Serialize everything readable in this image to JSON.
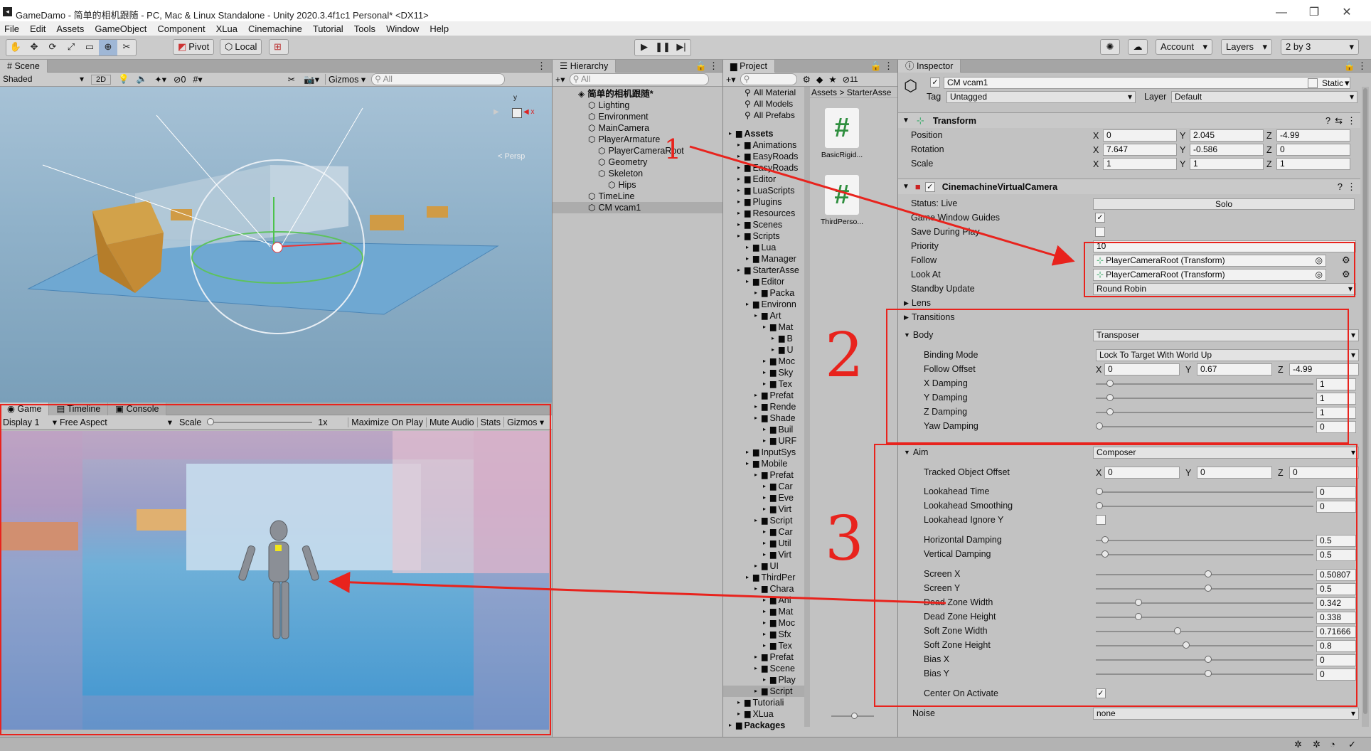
{
  "window": {
    "title": "GameDamo - 简单的相机跟随 - PC, Mac & Linux Standalone - Unity 2020.3.4f1c1 Personal* <DX11>"
  },
  "menu": [
    "File",
    "Edit",
    "Assets",
    "GameObject",
    "Component",
    "XLua",
    "Cinemachine",
    "Tutorial",
    "Tools",
    "Window",
    "Help"
  ],
  "toolbar": {
    "pivot": "Pivot",
    "local": "Local",
    "account": "Account",
    "layers": "Layers",
    "layout": "2 by 3"
  },
  "scene": {
    "tab": "Scene",
    "shading": "Shaded",
    "mode2d": "2D",
    "gizmos": "Gizmos",
    "search_placeholder": "All",
    "persp": "< Persp",
    "hidden_count": "0"
  },
  "game": {
    "tabs": [
      "Game",
      "Timeline",
      "Console"
    ],
    "display": "Display 1",
    "aspect": "Free Aspect",
    "scale_label": "Scale",
    "scale_value": "1x",
    "max_on_play": "Maximize On Play",
    "mute": "Mute Audio",
    "stats": "Stats",
    "gizmos": "Gizmos"
  },
  "hierarchy": {
    "tab": "Hierarchy",
    "search_placeholder": "All",
    "items": [
      {
        "label": "简单的相机跟随*",
        "depth": 0,
        "scene": true
      },
      {
        "label": "Lighting",
        "depth": 1
      },
      {
        "label": "Environment",
        "depth": 1
      },
      {
        "label": "MainCamera",
        "depth": 1
      },
      {
        "label": "PlayerArmature",
        "depth": 1
      },
      {
        "label": "PlayerCameraRoot",
        "depth": 2
      },
      {
        "label": "Geometry",
        "depth": 2
      },
      {
        "label": "Skeleton",
        "depth": 2
      },
      {
        "label": "Hips",
        "depth": 3
      },
      {
        "label": "TimeLine",
        "depth": 1
      },
      {
        "label": "CM vcam1",
        "depth": 1,
        "selected": true
      }
    ]
  },
  "project": {
    "tab": "Project",
    "hidden_count": "11",
    "breadcrumb": [
      "Assets",
      "StarterAsse"
    ],
    "favorites": [
      "All Material",
      "All Models",
      "All Prefabs"
    ],
    "tree": [
      {
        "label": "Assets",
        "d": 0,
        "bold": true
      },
      {
        "label": "Animations",
        "d": 1
      },
      {
        "label": "EasyRoads",
        "d": 1
      },
      {
        "label": "EasyRoads",
        "d": 1
      },
      {
        "label": "Editor",
        "d": 1
      },
      {
        "label": "LuaScripts",
        "d": 1
      },
      {
        "label": "Plugins",
        "d": 1
      },
      {
        "label": "Resources",
        "d": 1
      },
      {
        "label": "Scenes",
        "d": 1
      },
      {
        "label": "Scripts",
        "d": 1
      },
      {
        "label": "Lua",
        "d": 2
      },
      {
        "label": "Manager",
        "d": 2
      },
      {
        "label": "StarterAsse",
        "d": 1
      },
      {
        "label": "Editor",
        "d": 2
      },
      {
        "label": "Packa",
        "d": 3
      },
      {
        "label": "Environn",
        "d": 2
      },
      {
        "label": "Art",
        "d": 3
      },
      {
        "label": "Mat",
        "d": 4
      },
      {
        "label": "B",
        "d": 5
      },
      {
        "label": "U",
        "d": 5
      },
      {
        "label": "Moc",
        "d": 4
      },
      {
        "label": "Sky",
        "d": 4
      },
      {
        "label": "Tex",
        "d": 4
      },
      {
        "label": "Prefat",
        "d": 3
      },
      {
        "label": "Rende",
        "d": 3
      },
      {
        "label": "Shade",
        "d": 3
      },
      {
        "label": "Buil",
        "d": 4
      },
      {
        "label": "URF",
        "d": 4
      },
      {
        "label": "InputSys",
        "d": 2
      },
      {
        "label": "Mobile",
        "d": 2
      },
      {
        "label": "Prefat",
        "d": 3
      },
      {
        "label": "Car",
        "d": 4
      },
      {
        "label": "Eve",
        "d": 4
      },
      {
        "label": "Virt",
        "d": 4
      },
      {
        "label": "Script",
        "d": 3
      },
      {
        "label": "Car",
        "d": 4
      },
      {
        "label": "Util",
        "d": 4
      },
      {
        "label": "Virt",
        "d": 4
      },
      {
        "label": "UI",
        "d": 3
      },
      {
        "label": "ThirdPer",
        "d": 2
      },
      {
        "label": "Chara",
        "d": 3
      },
      {
        "label": "Ani",
        "d": 4
      },
      {
        "label": "Mat",
        "d": 4
      },
      {
        "label": "Moc",
        "d": 4
      },
      {
        "label": "Sfx",
        "d": 4
      },
      {
        "label": "Tex",
        "d": 4
      },
      {
        "label": "Prefat",
        "d": 3
      },
      {
        "label": "Scene",
        "d": 3
      },
      {
        "label": "Play",
        "d": 4
      },
      {
        "label": "Script",
        "d": 3,
        "selected": true
      },
      {
        "label": "Tutoriali",
        "d": 1
      },
      {
        "label": "XLua",
        "d": 1
      },
      {
        "label": "Packages",
        "d": 0,
        "bold": true
      }
    ],
    "assets": [
      {
        "label": "BasicRigid..."
      },
      {
        "label": "ThirdPerso..."
      }
    ]
  },
  "inspector": {
    "tab": "Inspector",
    "object_name": "CM vcam1",
    "static_label": "Static",
    "tag_label": "Tag",
    "tag_value": "Untagged",
    "layer_label": "Layer",
    "layer_value": "Default",
    "transform": {
      "title": "Transform",
      "rows": [
        {
          "label": "Position",
          "x": "0",
          "y": "2.045",
          "z": "-4.99"
        },
        {
          "label": "Rotation",
          "x": "7.647",
          "y": "-0.586",
          "z": "0"
        },
        {
          "label": "Scale",
          "x": "1",
          "y": "1",
          "z": "1"
        }
      ]
    },
    "vcam": {
      "title": "CinemachineVirtualCamera",
      "status": "Status: Live",
      "solo": "Solo",
      "game_window_guides": "Game Window Guides",
      "save_during_play": "Save During Play",
      "priority_label": "Priority",
      "priority": "10",
      "follow_label": "Follow",
      "follow": "PlayerCameraRoot (Transform)",
      "lookat_label": "Look At",
      "lookat": "PlayerCameraRoot (Transform)",
      "standby_label": "Standby Update",
      "standby": "Round Robin",
      "lens": "Lens",
      "transitions": "Transitions",
      "body_label": "Body",
      "body": "Transposer",
      "binding_label": "Binding Mode",
      "binding": "Lock To Target With World Up",
      "follow_offset_label": "Follow Offset",
      "follow_offset": {
        "x": "0",
        "y": "0.67",
        "z": "-4.99"
      },
      "body_sliders": [
        {
          "label": "X Damping",
          "value": "1",
          "frac": 0.05
        },
        {
          "label": "Y Damping",
          "value": "1",
          "frac": 0.05
        },
        {
          "label": "Z Damping",
          "value": "1",
          "frac": 0.05
        },
        {
          "label": "Yaw Damping",
          "value": "0",
          "frac": 0
        }
      ],
      "aim_label": "Aim",
      "aim": "Composer",
      "tracked_label": "Tracked Object Offset",
      "tracked": {
        "x": "0",
        "y": "0",
        "z": "0"
      },
      "aim_rows": [
        {
          "label": "Lookahead Time",
          "value": "0",
          "frac": 0
        },
        {
          "label": "Lookahead Smoothing",
          "value": "0",
          "frac": 0
        },
        {
          "label": "Lookahead Ignore Y",
          "checkbox": true
        },
        {
          "label": "Horizontal Damping",
          "value": "0.5",
          "frac": 0.025
        },
        {
          "label": "Vertical Damping",
          "value": "0.5",
          "frac": 0.025
        },
        {
          "label": "Screen X",
          "value": "0.50807",
          "frac": 0.5
        },
        {
          "label": "Screen Y",
          "value": "0.5",
          "frac": 0.5
        },
        {
          "label": "Dead Zone Width",
          "value": "0.342",
          "frac": 0.18
        },
        {
          "label": "Dead Zone Height",
          "value": "0.338",
          "frac": 0.18
        },
        {
          "label": "Soft Zone Width",
          "value": "0.71666",
          "frac": 0.36
        },
        {
          "label": "Soft Zone Height",
          "value": "0.8",
          "frac": 0.4
        },
        {
          "label": "Bias X",
          "value": "0",
          "frac": 0.5
        },
        {
          "label": "Bias Y",
          "value": "0",
          "frac": 0.5
        },
        {
          "label": "Center On Activate",
          "checkbox": true,
          "checked": true
        }
      ],
      "noise_label": "Noise",
      "noise": "none"
    }
  },
  "annotations": {
    "n1": "1",
    "n2": "2",
    "n3": "3"
  }
}
